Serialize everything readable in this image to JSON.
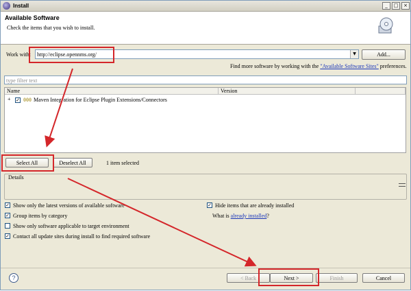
{
  "window": {
    "title": "Install"
  },
  "header": {
    "title": "Available Software",
    "subtitle": "Check the items that you wish to install."
  },
  "work_with": {
    "label": "Work with:",
    "value": "http://eclipse.opennms.org/",
    "add_label": "Add...",
    "find_more_prefix": "Find more software by working with the ",
    "find_more_link": "\"Available Software Sites\"",
    "find_more_suffix": " preferences."
  },
  "filter": {
    "placeholder": "type filter text"
  },
  "table": {
    "columns": [
      "Name",
      "Version"
    ],
    "rows": [
      {
        "name": "Maven Integration for Eclipse Plugin Extensions/Connectors",
        "version": "",
        "checked": true
      }
    ]
  },
  "selection": {
    "select_all": "Select All",
    "deselect_all": "Deselect All",
    "status": "1 item selected"
  },
  "details": {
    "label": "Details"
  },
  "options": {
    "latest_versions": {
      "label": "Show only the latest versions of available software",
      "checked": true
    },
    "group_by_category": {
      "label": "Group items by category",
      "checked": true
    },
    "target_env": {
      "label": "Show only software applicable to target environment",
      "checked": false
    },
    "contact_sites": {
      "label": "Contact all update sites during install to find required software",
      "checked": true
    },
    "hide_installed": {
      "label": "Hide items that are already installed",
      "checked": true
    },
    "what_is_prefix": "What is ",
    "what_is_link": "already installed",
    "what_is_suffix": "?"
  },
  "footer": {
    "help_symbol": "?",
    "back": "< Back",
    "next": "Next >",
    "finish": "Finish",
    "cancel": "Cancel"
  },
  "colors": {
    "annotation": "#d4262a",
    "link": "#1a36b9"
  }
}
